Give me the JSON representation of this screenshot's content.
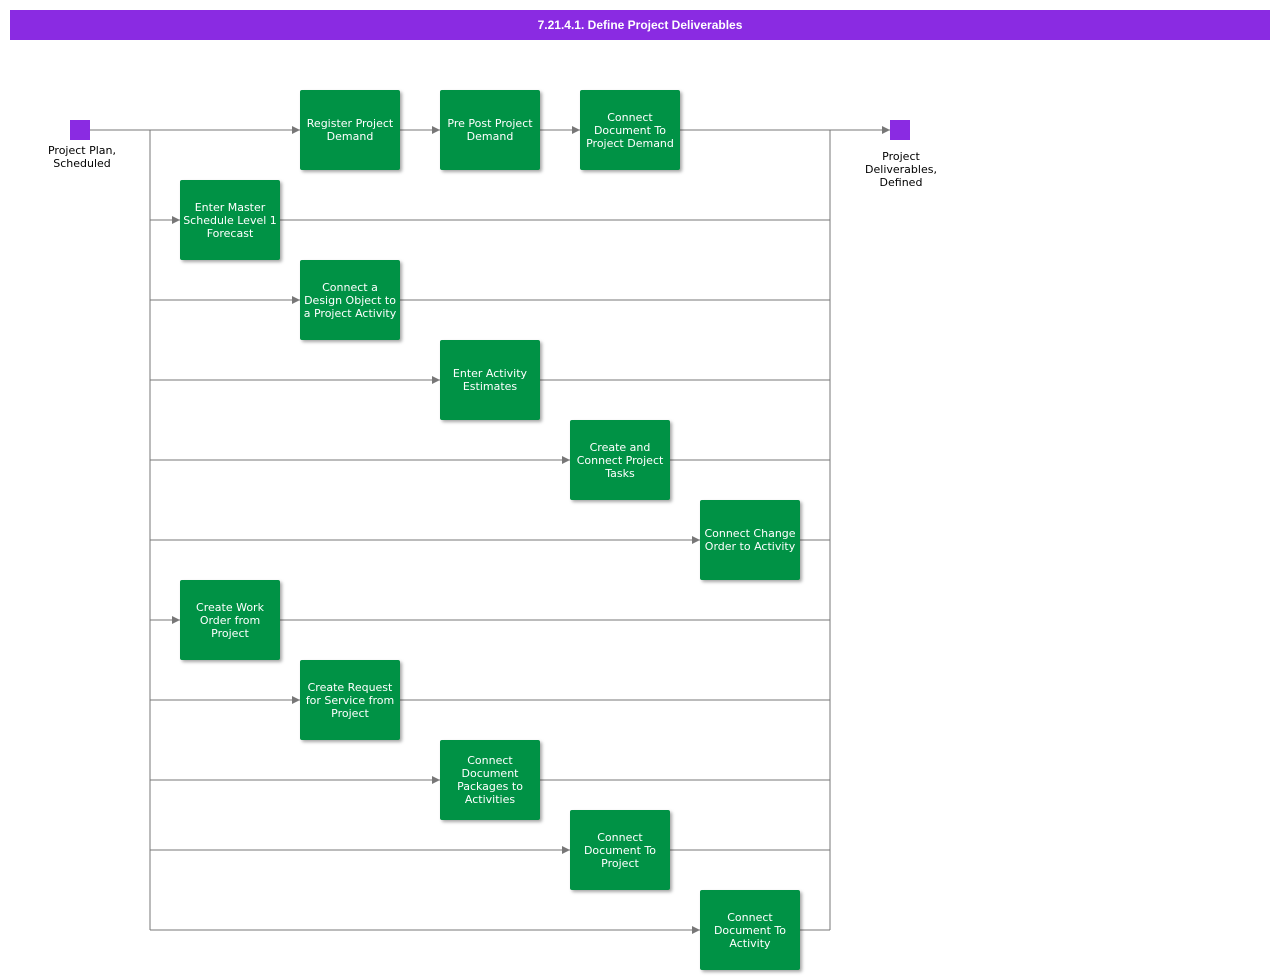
{
  "title": "7.21.4.1. Define Project Deliverables",
  "colors": {
    "title_bar": "#8a2be2",
    "event": "#8a2be2",
    "task": "#009245",
    "connector": "#777777"
  },
  "start_event": {
    "label": "Project Plan, Scheduled"
  },
  "end_event": {
    "label": "Project Deliverables, Defined"
  },
  "tasks": [
    {
      "label": "Register Project Demand"
    },
    {
      "label": "Pre Post Project Demand"
    },
    {
      "label": "Connect Document To Project Demand"
    },
    {
      "label": "Enter Master Schedule Level 1 Forecast"
    },
    {
      "label": "Connect a Design Object to a Project Activity"
    },
    {
      "label": "Enter Activity Estimates"
    },
    {
      "label": "Create and Connect Project Tasks"
    },
    {
      "label": "Connect Change Order to Activity"
    },
    {
      "label": "Create Work Order from Project"
    },
    {
      "label": "Create Request for Service from Project"
    },
    {
      "label": "Connect Document Packages to Activities"
    },
    {
      "label": "Connect Document To Project"
    },
    {
      "label": "Connect Document To Activity"
    }
  ]
}
